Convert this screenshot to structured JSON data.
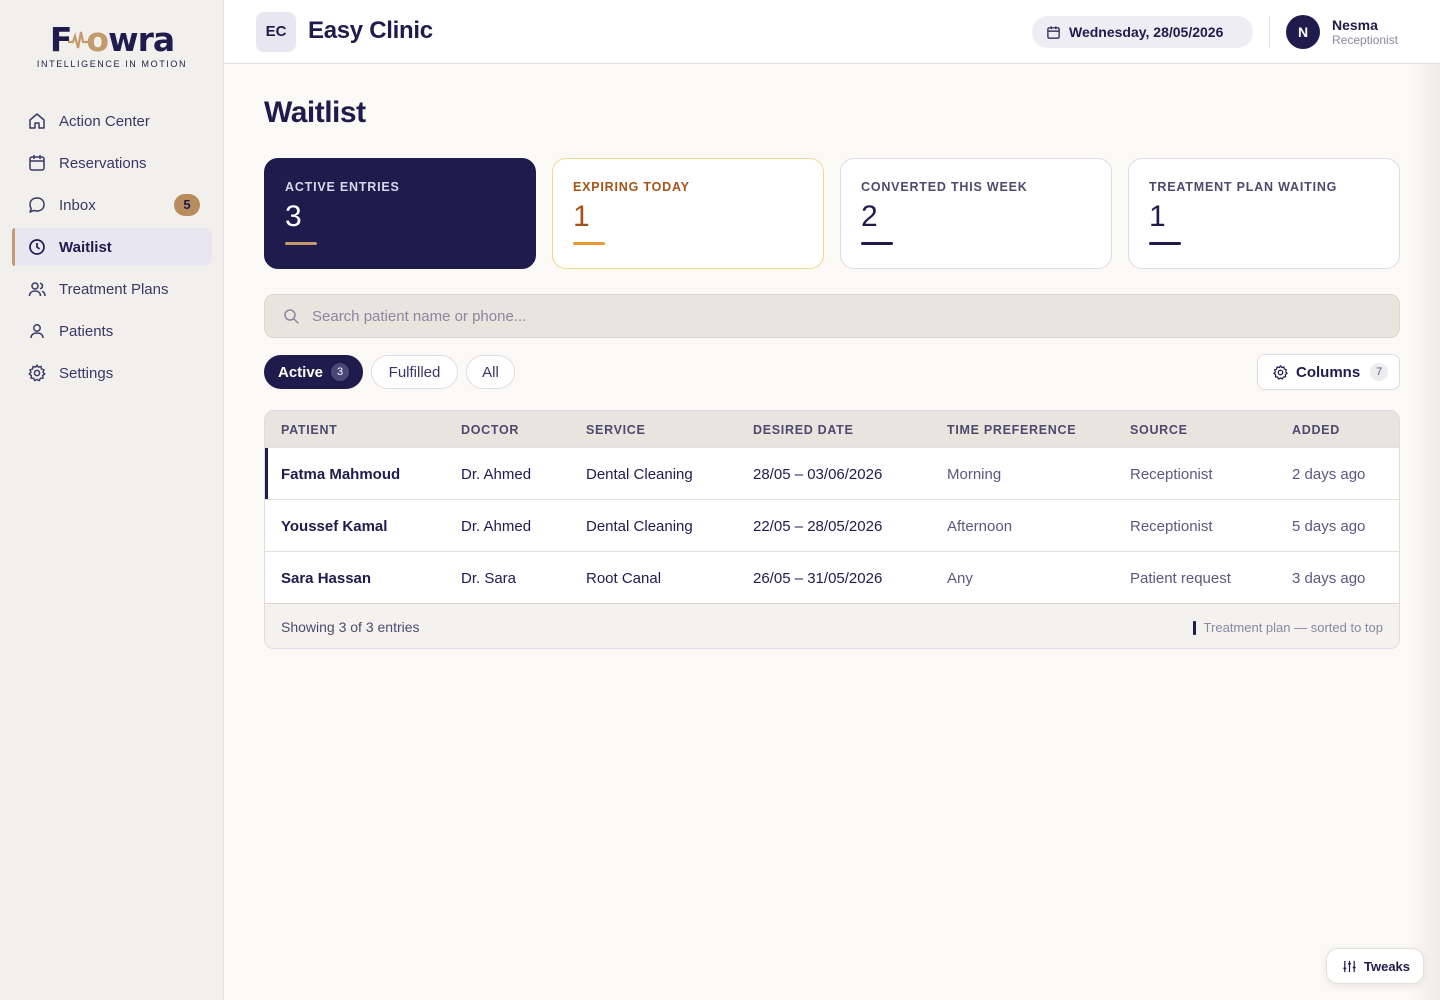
{
  "brand": {
    "name": "Flowra",
    "tagline": "INTELLIGENCE IN MOTION",
    "accent": "#c49a6c",
    "primary": "#1f1b4d"
  },
  "sidebar": {
    "items": [
      {
        "label": "Action Center",
        "icon": "home-icon"
      },
      {
        "label": "Reservations",
        "icon": "calendar-icon"
      },
      {
        "label": "Inbox",
        "icon": "chat-icon",
        "badge": "5"
      },
      {
        "label": "Waitlist",
        "icon": "clock-icon",
        "active": true
      },
      {
        "label": "Treatment Plans",
        "icon": "users-icon"
      },
      {
        "label": "Patients",
        "icon": "user-icon"
      },
      {
        "label": "Settings",
        "icon": "gear-icon"
      }
    ]
  },
  "header": {
    "clinic_initials": "EC",
    "clinic_name": "Easy Clinic",
    "date": "Wednesday, 28/05/2026",
    "user": {
      "initial": "N",
      "name": "Nesma",
      "role": "Receptionist"
    }
  },
  "page": {
    "title": "Waitlist"
  },
  "stats": [
    {
      "label": "ACTIVE ENTRIES",
      "value": "3"
    },
    {
      "label": "EXPIRING TODAY",
      "value": "1"
    },
    {
      "label": "CONVERTED THIS WEEK",
      "value": "2"
    },
    {
      "label": "TREATMENT PLAN WAITING",
      "value": "1"
    }
  ],
  "search": {
    "placeholder": "Search patient name or phone..."
  },
  "filters": [
    {
      "label": "Active",
      "count": "3",
      "active": true
    },
    {
      "label": "Fulfilled"
    },
    {
      "label": "All"
    }
  ],
  "columns_button": {
    "label": "Columns",
    "count": "7"
  },
  "table": {
    "headers": [
      "PATIENT",
      "DOCTOR",
      "SERVICE",
      "DESIRED DATE",
      "TIME PREFERENCE",
      "SOURCE",
      "ADDED"
    ],
    "rows": [
      {
        "patient": "Fatma Mahmoud",
        "doctor": "Dr. Ahmed",
        "service": "Dental Cleaning",
        "date": "28/05 – 03/06/2026",
        "time": "Morning",
        "source": "Receptionist",
        "added": "2 days ago",
        "treatment_plan": true
      },
      {
        "patient": "Youssef Kamal",
        "doctor": "Dr. Ahmed",
        "service": "Dental Cleaning",
        "date": "22/05 – 28/05/2026",
        "time": "Afternoon",
        "source": "Receptionist",
        "added": "5 days ago"
      },
      {
        "patient": "Sara Hassan",
        "doctor": "Dr. Sara",
        "service": "Root Canal",
        "date": "26/05 – 31/05/2026",
        "time": "Any",
        "source": "Patient request",
        "added": "3 days ago"
      }
    ],
    "footer": {
      "showing": "Showing 3 of 3 entries",
      "legend": "Treatment plan — sorted to top"
    }
  },
  "tweaks": {
    "label": "Tweaks"
  }
}
